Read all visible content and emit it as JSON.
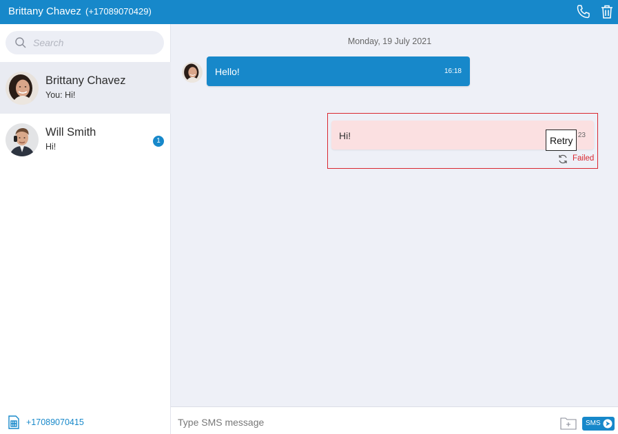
{
  "header": {
    "contact_name": "Brittany Chavez",
    "contact_phone": "(+17089070429)"
  },
  "sidebar": {
    "search_placeholder": "Search",
    "conversations": [
      {
        "name": "Brittany Chavez",
        "preview": "You: Hi!",
        "active": true,
        "unread": null
      },
      {
        "name": "Will Smith",
        "preview": "Hi!",
        "active": false,
        "unread": "1"
      }
    ],
    "my_number": "+17089070415"
  },
  "chat": {
    "date_separator": "Monday, 19 July 2021",
    "messages": [
      {
        "direction": "incoming",
        "text": "Hello!",
        "time": "16:18"
      },
      {
        "direction": "outgoing",
        "text": "Hi!",
        "time": "23",
        "status": "Failed",
        "tooltip": "Retry"
      }
    ]
  },
  "composer": {
    "placeholder": "Type SMS message",
    "send_label": "SMS"
  },
  "colors": {
    "accent": "#1788ca",
    "failed": "#d9262e",
    "failed_bubble": "#fbe0e1",
    "background": "#eef0f7"
  },
  "icons": [
    "phone-icon",
    "trash-icon",
    "search-icon",
    "sim-card-icon",
    "retry-icon",
    "attach-folder-icon",
    "send-arrow-icon"
  ]
}
